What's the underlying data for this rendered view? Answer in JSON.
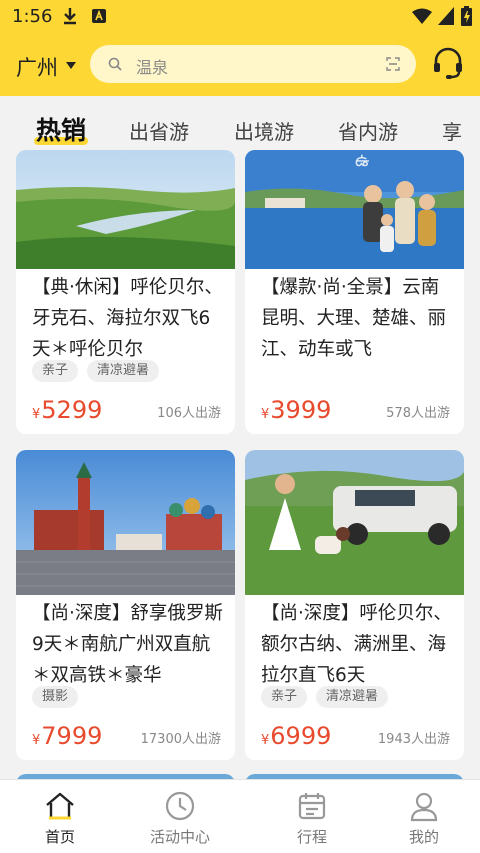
{
  "status_bar": {
    "time": "1:56"
  },
  "header": {
    "city": "广州",
    "search_placeholder": "温泉",
    "icons": [
      "download-icon",
      "app-a-icon",
      "wifi-icon",
      "signal-icon",
      "battery-icon",
      "chevron-down-icon",
      "search-icon",
      "scan-icon",
      "customer-service-icon"
    ]
  },
  "tabs": [
    {
      "label": "热销",
      "active": true
    },
    {
      "label": "出省游"
    },
    {
      "label": "出境游"
    },
    {
      "label": "省内游"
    },
    {
      "label": "享"
    }
  ],
  "cards": [
    {
      "title": "【典·休闲】呼伦贝尔、牙克石、海拉尔双飞6天＊呼伦贝尔",
      "tags": [
        "亲子",
        "清凉避暑"
      ],
      "currency": "¥",
      "price": "5299",
      "sold": "106人出游"
    },
    {
      "title": "【爆款·尚·全景】云南昆明、大理、楚雄、丽江、动车或飞",
      "tags": [],
      "currency": "¥",
      "price": "3999",
      "sold": "578人出游"
    },
    {
      "title": "【尚·深度】舒享俄罗斯9天＊南航广州双直航＊双高铁＊豪华",
      "tags": [
        "摄影"
      ],
      "currency": "¥",
      "price": "7999",
      "sold": "17300人出游"
    },
    {
      "title": "【尚·深度】呼伦贝尔、额尔古纳、满洲里、海拉尔直飞6天",
      "tags": [
        "亲子",
        "清凉避暑"
      ],
      "currency": "¥",
      "price": "6999",
      "sold": "1943人出游"
    }
  ],
  "bottom_nav": [
    {
      "label": "首页",
      "icon": "home-icon",
      "active": true
    },
    {
      "label": "活动中心",
      "icon": "clock-icon"
    },
    {
      "label": "行程",
      "icon": "calendar-icon"
    },
    {
      "label": "我的",
      "icon": "user-icon"
    }
  ],
  "colors": {
    "brand_yellow": "#fdd835",
    "price_red": "#e84a2e"
  }
}
